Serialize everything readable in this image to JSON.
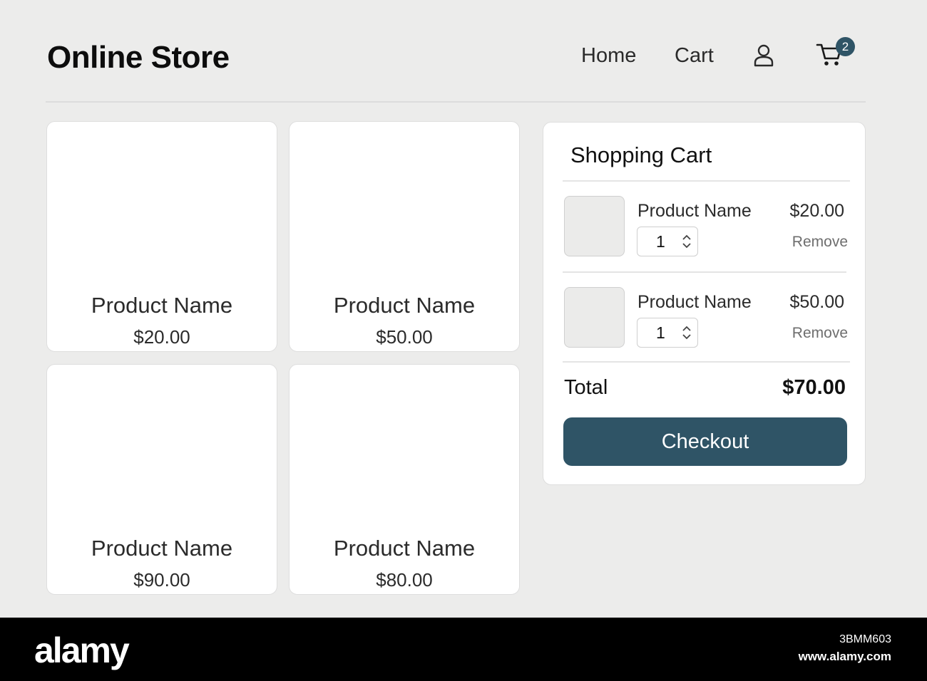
{
  "header": {
    "brand": "Online Store",
    "nav": {
      "home": "Home",
      "cart": "Cart"
    },
    "icons": {
      "user": "user-icon",
      "cart": "cart-icon"
    },
    "cart_count": "2"
  },
  "products": [
    {
      "name": "Product Name",
      "price": "$20.00"
    },
    {
      "name": "Product Name",
      "price": "$50.00"
    },
    {
      "name": "Product Name",
      "price": "$90.00"
    },
    {
      "name": "Product Name",
      "price": "$80.00"
    }
  ],
  "cart": {
    "title": "Shopping Cart",
    "items": [
      {
        "name": "Product Name",
        "price": "$20.00",
        "qty": "1",
        "remove_label": "Remove"
      },
      {
        "name": "Product Name",
        "price": "$50.00",
        "qty": "1",
        "remove_label": "Remove"
      }
    ],
    "total_label": "Total",
    "total_value": "$70.00",
    "checkout_label": "Checkout"
  },
  "stock": {
    "logo": "alamy",
    "image_id": "3BMM603",
    "url": "www.alamy.com"
  },
  "colors": {
    "accent": "#2f5466",
    "background": "#ececeb",
    "card": "#ffffff"
  }
}
